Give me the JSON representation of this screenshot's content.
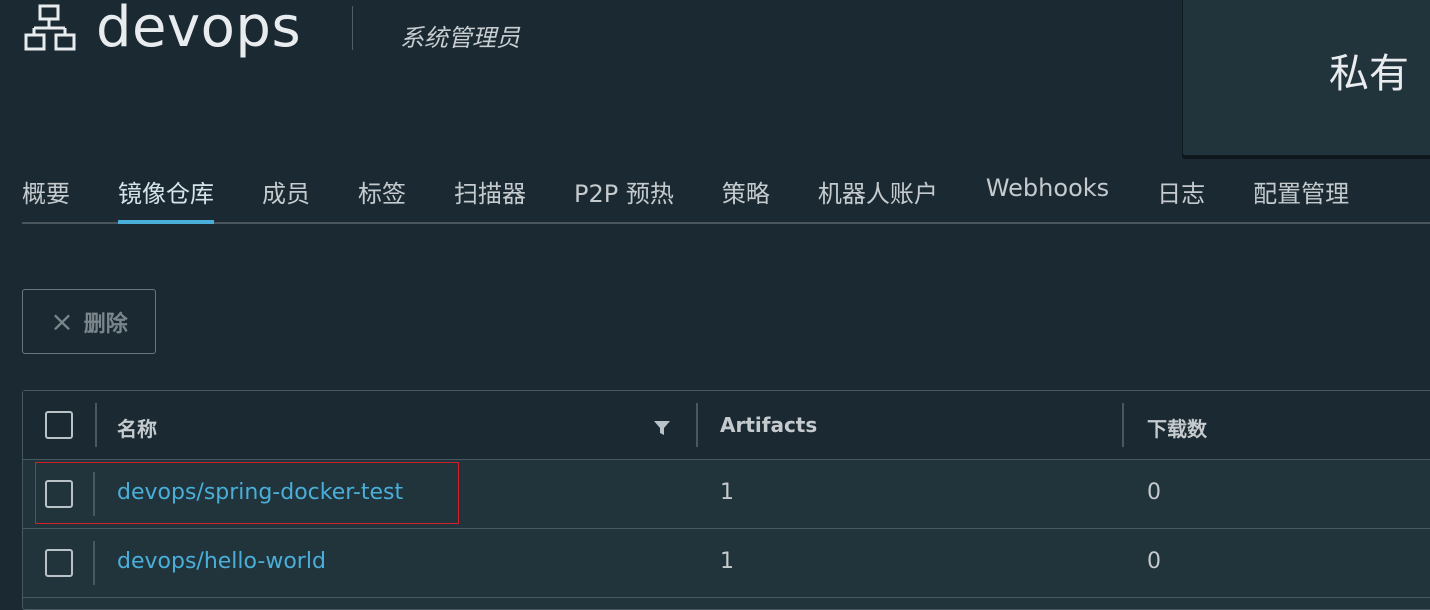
{
  "header": {
    "project_name": "devops",
    "role": "系统管理员",
    "access_level": "私有",
    "project_icon": "project-icon"
  },
  "tabs": [
    {
      "label": "概要",
      "active": false
    },
    {
      "label": "镜像仓库",
      "active": true
    },
    {
      "label": "成员",
      "active": false
    },
    {
      "label": "标签",
      "active": false
    },
    {
      "label": "扫描器",
      "active": false
    },
    {
      "label": "P2P 预热",
      "active": false
    },
    {
      "label": "策略",
      "active": false
    },
    {
      "label": "机器人账户",
      "active": false
    },
    {
      "label": "Webhooks",
      "active": false
    },
    {
      "label": "日志",
      "active": false
    },
    {
      "label": "配置管理",
      "active": false
    }
  ],
  "toolbar": {
    "delete_label": "删除",
    "delete_icon": "×"
  },
  "table": {
    "columns": [
      "名称",
      "Artifacts",
      "下载数"
    ],
    "rows": [
      {
        "name": "devops/spring-docker-test",
        "artifacts": "1",
        "downloads": "0",
        "highlighted": true
      },
      {
        "name": "devops/hello-world",
        "artifacts": "1",
        "downloads": "0",
        "highlighted": false
      }
    ]
  },
  "colors": {
    "background": "#1b2a32",
    "accent": "#49afd9",
    "highlight_border": "#d0202a"
  }
}
